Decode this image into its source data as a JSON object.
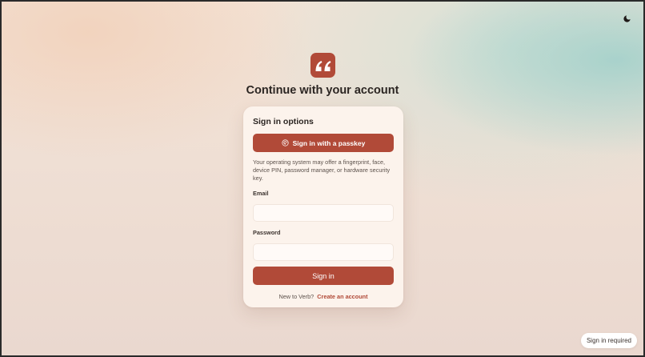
{
  "page": {
    "heading": "Continue with your account"
  },
  "icons": {
    "theme_toggle": "moon-icon",
    "logo": "quote-icon",
    "passkey": "fingerprint-icon"
  },
  "colors": {
    "accent": "#b14a38",
    "card_background": "#fcf3ec",
    "text": "#2b2522"
  },
  "card": {
    "title": "Sign in options",
    "passkey_button_label": "Sign in with a passkey",
    "passkey_hint": "Your operating system may offer a fingerprint, face, device PIN, password manager, or hardware security key.",
    "email_label": "Email",
    "email_value": "",
    "password_label": "Password",
    "password_value": "",
    "signin_button_label": "Sign in",
    "footer_text": "New to Verb?",
    "create_account_link": "Create an account"
  },
  "status": {
    "pill": "Sign in required"
  }
}
